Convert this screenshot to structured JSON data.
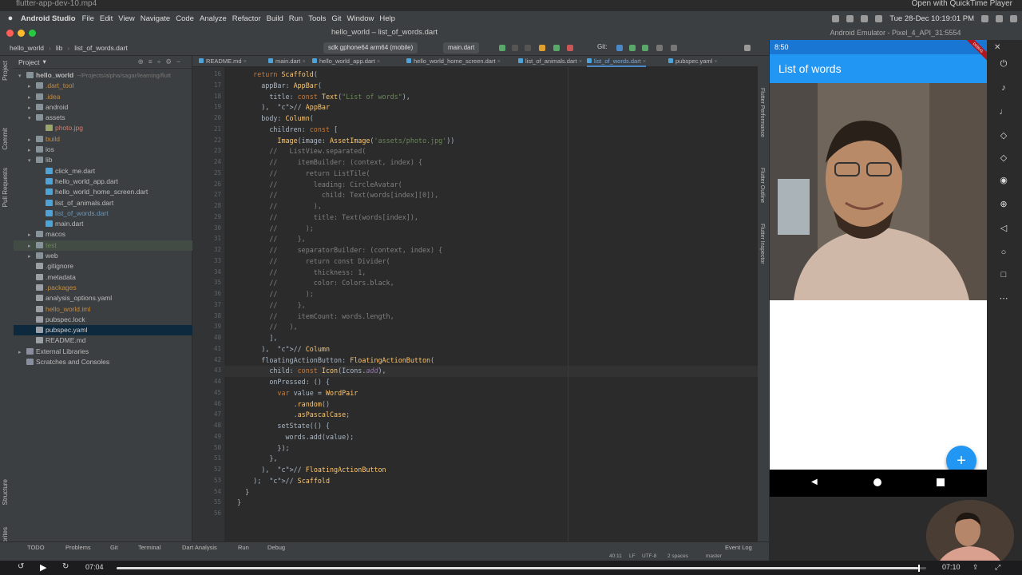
{
  "player_top": {
    "title": "flutter-app-dev-10.mp4",
    "right": "Open with QuickTime Player"
  },
  "menubar": {
    "app": "Android Studio",
    "items": [
      "File",
      "Edit",
      "View",
      "Navigate",
      "Code",
      "Analyze",
      "Refactor",
      "Build",
      "Run",
      "Tools",
      "Git",
      "Window",
      "Help"
    ],
    "clock": "Tue 28-Dec 10:19:01 PM"
  },
  "ide": {
    "window_title": "hello_world – list_of_words.dart",
    "breadcrumbs": [
      "hello_world",
      "lib",
      "list_of_words.dart"
    ],
    "device_select": "sdk gphone64 arm64 (mobile)",
    "run_config": "main.dart",
    "git_label": "Git:",
    "project_panel_title": "Project",
    "tree": [
      {
        "label": "hello_world",
        "path": "~/Projects/alpha/sagar/learning/flutt",
        "indent": 0,
        "arrow": "▾",
        "icon": "folder",
        "style": ""
      },
      {
        "label": ".dart_tool",
        "indent": 1,
        "arrow": "▸",
        "icon": "folder",
        "style": "excluded"
      },
      {
        "label": ".idea",
        "indent": 1,
        "arrow": "▸",
        "icon": "folder",
        "style": "excluded"
      },
      {
        "label": "android",
        "indent": 1,
        "arrow": "▸",
        "icon": "folder",
        "style": ""
      },
      {
        "label": "assets",
        "indent": 1,
        "arrow": "▾",
        "icon": "folder",
        "style": ""
      },
      {
        "label": "photo.jpg",
        "indent": 2,
        "arrow": "",
        "icon": "image",
        "style": "untracked"
      },
      {
        "label": "build",
        "indent": 1,
        "arrow": "▸",
        "icon": "folder",
        "style": "excluded"
      },
      {
        "label": "ios",
        "indent": 1,
        "arrow": "▸",
        "icon": "folder",
        "style": ""
      },
      {
        "label": "lib",
        "indent": 1,
        "arrow": "▾",
        "icon": "folder",
        "style": ""
      },
      {
        "label": "click_me.dart",
        "indent": 2,
        "arrow": "",
        "icon": "dart",
        "style": ""
      },
      {
        "label": "hello_world_app.dart",
        "indent": 2,
        "arrow": "",
        "icon": "dart",
        "style": ""
      },
      {
        "label": "hello_world_home_screen.dart",
        "indent": 2,
        "arrow": "",
        "icon": "dart",
        "style": ""
      },
      {
        "label": "list_of_animals.dart",
        "indent": 2,
        "arrow": "",
        "icon": "dart",
        "style": ""
      },
      {
        "label": "list_of_words.dart",
        "indent": 2,
        "arrow": "",
        "icon": "dart",
        "style": "modified"
      },
      {
        "label": "main.dart",
        "indent": 2,
        "arrow": "",
        "icon": "dart",
        "style": ""
      },
      {
        "label": "macos",
        "indent": 1,
        "arrow": "▸",
        "icon": "folder",
        "style": ""
      },
      {
        "label": "test",
        "indent": 1,
        "arrow": "▸",
        "icon": "folder",
        "style": "hl"
      },
      {
        "label": "web",
        "indent": 1,
        "arrow": "▸",
        "icon": "folder",
        "style": ""
      },
      {
        "label": ".gitignore",
        "indent": 1,
        "arrow": "",
        "icon": "file",
        "style": ""
      },
      {
        "label": ".metadata",
        "indent": 1,
        "arrow": "",
        "icon": "file",
        "style": ""
      },
      {
        "label": ".packages",
        "indent": 1,
        "arrow": "",
        "icon": "file",
        "style": "excluded"
      },
      {
        "label": "analysis_options.yaml",
        "indent": 1,
        "arrow": "",
        "icon": "file",
        "style": ""
      },
      {
        "label": "hello_world.iml",
        "indent": 1,
        "arrow": "",
        "icon": "file",
        "style": "excluded"
      },
      {
        "label": "pubspec.lock",
        "indent": 1,
        "arrow": "",
        "icon": "file",
        "style": ""
      },
      {
        "label": "pubspec.yaml",
        "indent": 1,
        "arrow": "",
        "icon": "file",
        "style": "sel"
      },
      {
        "label": "README.md",
        "indent": 1,
        "arrow": "",
        "icon": "file",
        "style": ""
      },
      {
        "label": "External Libraries",
        "indent": 0,
        "arrow": "▸",
        "icon": "lib",
        "style": ""
      },
      {
        "label": "Scratches and Consoles",
        "indent": 0,
        "arrow": "",
        "icon": "lib",
        "style": ""
      }
    ],
    "tabs": [
      {
        "label": "README.md",
        "active": false
      },
      {
        "label": "main.dart",
        "active": false
      },
      {
        "label": "hello_world_app.dart",
        "active": false
      },
      {
        "label": "hello_world_home_screen.dart",
        "active": false
      },
      {
        "label": "list_of_animals.dart",
        "active": false
      },
      {
        "label": "list_of_words.dart",
        "active": true
      },
      {
        "label": "pubspec.yaml",
        "active": false
      }
    ],
    "code_start_line": 16,
    "code": [
      "    return Scaffold(",
      "      appBar: AppBar(",
      "        title: const Text(\"List of words\"),",
      "      ),  // AppBar",
      "      body: Column(",
      "        children: const [",
      "          Image(image: AssetImage('assets/photo.jpg'))",
      "        //   ListView.separated(",
      "        //     itemBuilder: (context, index) {",
      "        //       return ListTile(",
      "        //         leading: CircleAvatar(",
      "        //           child: Text(words[index][0]),",
      "        //         ),",
      "        //         title: Text(words[index]),",
      "        //       );",
      "        //     },",
      "        //     separatorBuilder: (context, index) {",
      "        //       return const Divider(",
      "        //         thickness: 1,",
      "        //         color: Colors.black,",
      "        //       );",
      "        //     },",
      "        //     itemCount: words.length,",
      "        //   ),",
      "        ],",
      "      ),  // Column",
      "      floatingActionButton: FloatingActionButton(",
      "        child: const Icon(Icons.add),",
      "        onPressed: () {",
      "          var value = WordPair",
      "              .random()",
      "              .asPascalCase;",
      "          setState(() {",
      "            words.add(value);",
      "          });",
      "        },",
      "      ),  // FloatingActionButton",
      "    );  // Scaffold",
      "  }",
      "}",
      ""
    ],
    "left_strip": [
      "Project",
      "Commit",
      "Pull Requests",
      "Structure",
      "Favorites"
    ],
    "right_strip": [
      "Flutter Performance",
      "Flutter Outline",
      "Flutter Inspector"
    ],
    "bottom_tools": [
      "TODO",
      "Problems",
      "Git",
      "Terminal",
      "Dart Analysis",
      "Run",
      "Debug"
    ],
    "event_log": "Event Log",
    "status": {
      "position": "40:11",
      "line_sep": "LF",
      "encoding": "UTF-8",
      "indent": "2 spaces",
      "branch": "master"
    }
  },
  "emulator": {
    "window_title": "Android Emulator - Pixel_4_API_31:5554",
    "phone_time": "8:50",
    "app_title": "List of words",
    "debug_banner": "DEBUG",
    "fab_label": "+",
    "accent": "#2196f3"
  },
  "player": {
    "current": "07:04",
    "total": "07:10",
    "progress": 0.99
  }
}
